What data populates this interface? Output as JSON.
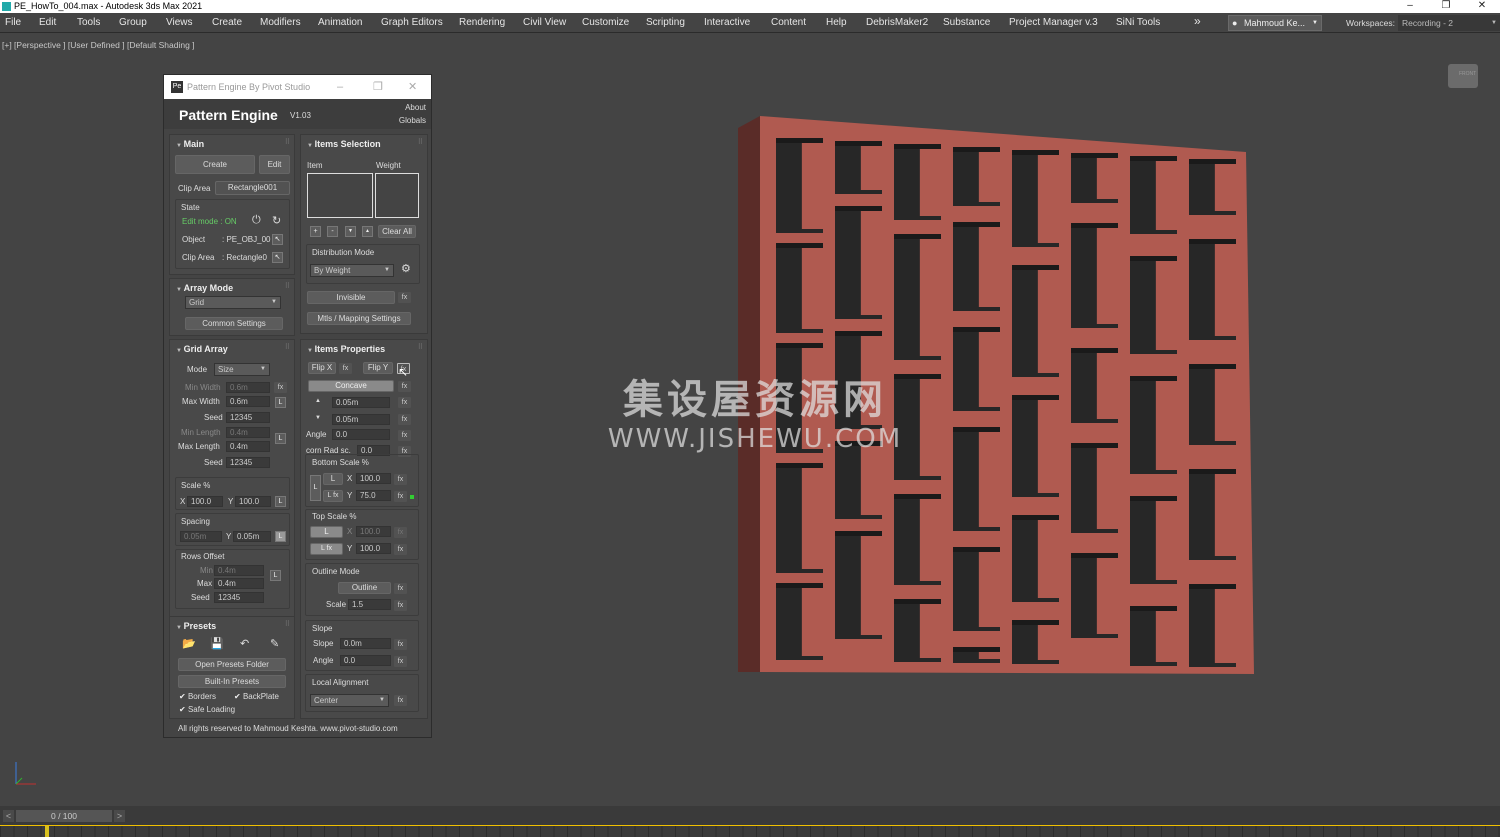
{
  "window": {
    "title": "PE_HowTo_004.max - Autodesk 3ds Max 2021",
    "min": "–",
    "max": "❐",
    "close": "✕"
  },
  "menu": [
    "File",
    "Edit",
    "Tools",
    "Group",
    "Views",
    "Create",
    "Modifiers",
    "Animation",
    "Graph Editors",
    "Rendering",
    "Civil View",
    "Customize",
    "Scripting",
    "Interactive",
    "Content",
    "Help",
    "DebrisMaker2",
    "Substance",
    "Project Manager v.3",
    "SiNi Tools"
  ],
  "menu_more": "»",
  "user": "Mahmoud Ke...",
  "workspace_label": "Workspaces:",
  "workspace_value": "Recording - 2",
  "viewport_label": "[+] [Perspective ] [User Defined ] [Default Shading ]",
  "navcube": "FRONT",
  "watermark": {
    "line1": "集设屋资源网",
    "line2": "WWW.JISHEWU.COM"
  },
  "timeline": {
    "frame": "0 / 100",
    "prev": "<",
    "next": ">"
  },
  "colors": {
    "shelf_front": "#b05a50",
    "shelf_side": "#5a2c28",
    "shelf_back": "#272727",
    "accent": "#f0c000"
  },
  "panel": {
    "window_title": "Pattern Engine By Pivot Studio",
    "title": "Pattern Engine",
    "version": "V1.03",
    "about": "About",
    "globals": "Globals",
    "main": {
      "header": "Main",
      "create": "Create",
      "edit": "Edit",
      "clip_area_label": "Clip Area",
      "clip_area_value": "Rectangle001",
      "state": "State",
      "edit_mode": "Edit mode : ON",
      "object_label": "Object",
      "object_value": ": PE_OBJ_00",
      "clip_label": "Clip Area",
      "clip_value": ": Rectangle0"
    },
    "array_mode": {
      "header": "Array Mode",
      "value": "Grid",
      "common": "Common Settings"
    },
    "grid_array": {
      "header": "Grid Array",
      "mode_label": "Mode",
      "mode_value": "Size",
      "min_width_label": "Min Width",
      "min_width": "0.6m",
      "max_width_label": "Max Width",
      "max_width": "0.6m",
      "seed_label": "Seed",
      "seed1": "12345",
      "min_length_label": "Min Length",
      "min_length": "0.4m",
      "max_length_label": "Max Length",
      "max_length": "0.4m",
      "seed2": "12345",
      "scale_label": "Scale %",
      "x_label": "X",
      "scale_x": "100.0",
      "y_label": "Y",
      "scale_y": "100.0",
      "spacing_label": "Spacing",
      "spacing_x": "0.05m",
      "spacing_y": "0.05m",
      "rows_offset": "Rows Offset",
      "min_label": "Min",
      "ro_min": "0.4m",
      "max_label": "Max",
      "ro_max": "0.4m",
      "ro_seed": "12345",
      "lock": "L"
    },
    "presets": {
      "header": "Presets",
      "open": "Open Presets Folder",
      "builtin": "Built-In Presets",
      "borders": "Borders",
      "backplate": "BackPlate",
      "safe": "Safe Loading"
    },
    "items_selection": {
      "header": "Items Selection",
      "item": "Item",
      "weight": "Weight",
      "plus": "+",
      "minus": "-",
      "down": "▼",
      "up": "▲",
      "clear": "Clear All",
      "dist_label": "Distribution Mode",
      "dist_value": "By Weight",
      "invisible": "Invisible",
      "mtls": "Mtls / Mapping Settings"
    },
    "items_properties": {
      "header": "Items Properties",
      "flipx": "Flip X",
      "flipy": "Flip Y",
      "concave": "Concave",
      "up_val": "0.05m",
      "down_val": "0.05m",
      "angle_label": "Angle",
      "angle": "0.0",
      "corn_label": "corn Rad sc.",
      "corn": "0.0",
      "bottom_scale": "Bottom Scale %",
      "bs_x": "100.0",
      "bs_y": "75.0",
      "top_scale": "Top Scale %",
      "ts_x": "100.0",
      "ts_y": "100.0",
      "outline_mode": "Outline Mode",
      "outline": "Outline",
      "scale_label": "Scale",
      "scale": "1.5",
      "slope_group": "Slope",
      "slope_label": "Slope",
      "slope": "0.0m",
      "slope_angle_label": "Angle",
      "slope_angle": "0.0",
      "local_align": "Local Alignment",
      "align_value": "Center",
      "fx": "fx",
      "l": "L",
      "lfx": "L fx"
    },
    "footer": "All rights reserved to Mahmoud Keshta. www.pivot-studio.com"
  }
}
